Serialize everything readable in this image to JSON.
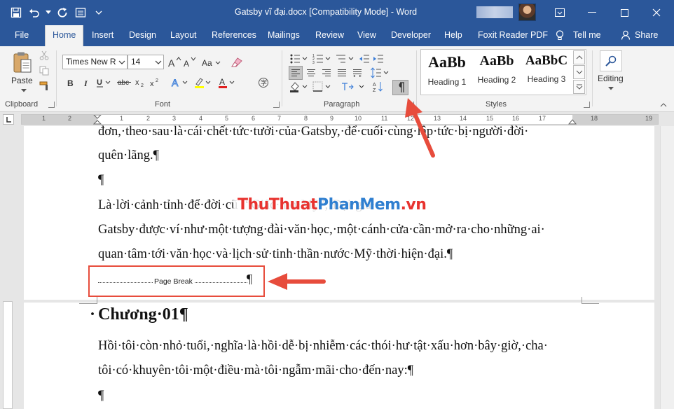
{
  "window": {
    "title": "Gatsby vĩ đại.docx [Compatibility Mode]  -  Word"
  },
  "tabs": [
    "File",
    "Home",
    "Insert",
    "Design",
    "Layout",
    "References",
    "Mailings",
    "Review",
    "View",
    "Developer",
    "Help",
    "Foxit Reader PDF",
    "Tell me",
    "Share"
  ],
  "ribbon": {
    "clipboard": {
      "label": "Clipboard",
      "paste": "Paste"
    },
    "font": {
      "label": "Font",
      "name": "Times New R",
      "size": "14"
    },
    "paragraph": {
      "label": "Paragraph"
    },
    "styles": {
      "label": "Styles",
      "items": [
        {
          "sample": "AaBb",
          "name": "Heading 1"
        },
        {
          "sample": "AaBb",
          "name": "Heading 2"
        },
        {
          "sample": "AaBbC",
          "name": "Heading 3"
        }
      ]
    },
    "editing": {
      "label": "Editing"
    }
  },
  "ruler_numbers": [
    "1",
    "2",
    "1",
    "1",
    "2",
    "3",
    "4",
    "5",
    "6",
    "7",
    "8",
    "9",
    "10",
    "11",
    "12",
    "13",
    "14",
    "15",
    "16",
    "17",
    "18",
    "19"
  ],
  "document": {
    "lines_before": [
      "đơn,·theo·sau·là·cái·chết·tức·tưởi·của·Gatsby,·để·cuối·cùng·lập·tức·bị·người·đời·",
      "quên·lãng.¶",
      "¶",
      "Là·lời·cảnh·tỉnh·để·đời·cũ                                    ·“Giấc·mơ·Mỹ”,·Đại·gia·",
      "Gatsby·được·ví·như·một·tượng·đài·văn·học,·một·cánh·cửa·cần·mở·ra·cho·những·ai·",
      "quan·tâm·tới·văn·học·và·lịch·sử·tinh·thần·nước·Mỹ·thời·hiện·đại.¶"
    ],
    "page_break_label": "Page Break",
    "page_break_mark": "¶",
    "heading_bullet": "·",
    "heading": "Chương·01¶",
    "lines_after": [
      "Hồi·tôi·còn·nhỏ·tuổi,·nghĩa·là·hồi·dễ·bị·nhiễm·các·thói·hư·tật·xấu·hơn·bây·giờ,·cha·",
      "tôi·có·khuyên·tôi·một·điều·mà·tôi·ngẫm·mãi·cho·đến·nay:¶",
      "¶"
    ]
  },
  "watermark": {
    "part1": "ThuThuat",
    "part2": "PhanMem",
    "part3": ".vn"
  },
  "colors": {
    "accent": "#2b579a",
    "annotation_red": "#e74c3c"
  }
}
